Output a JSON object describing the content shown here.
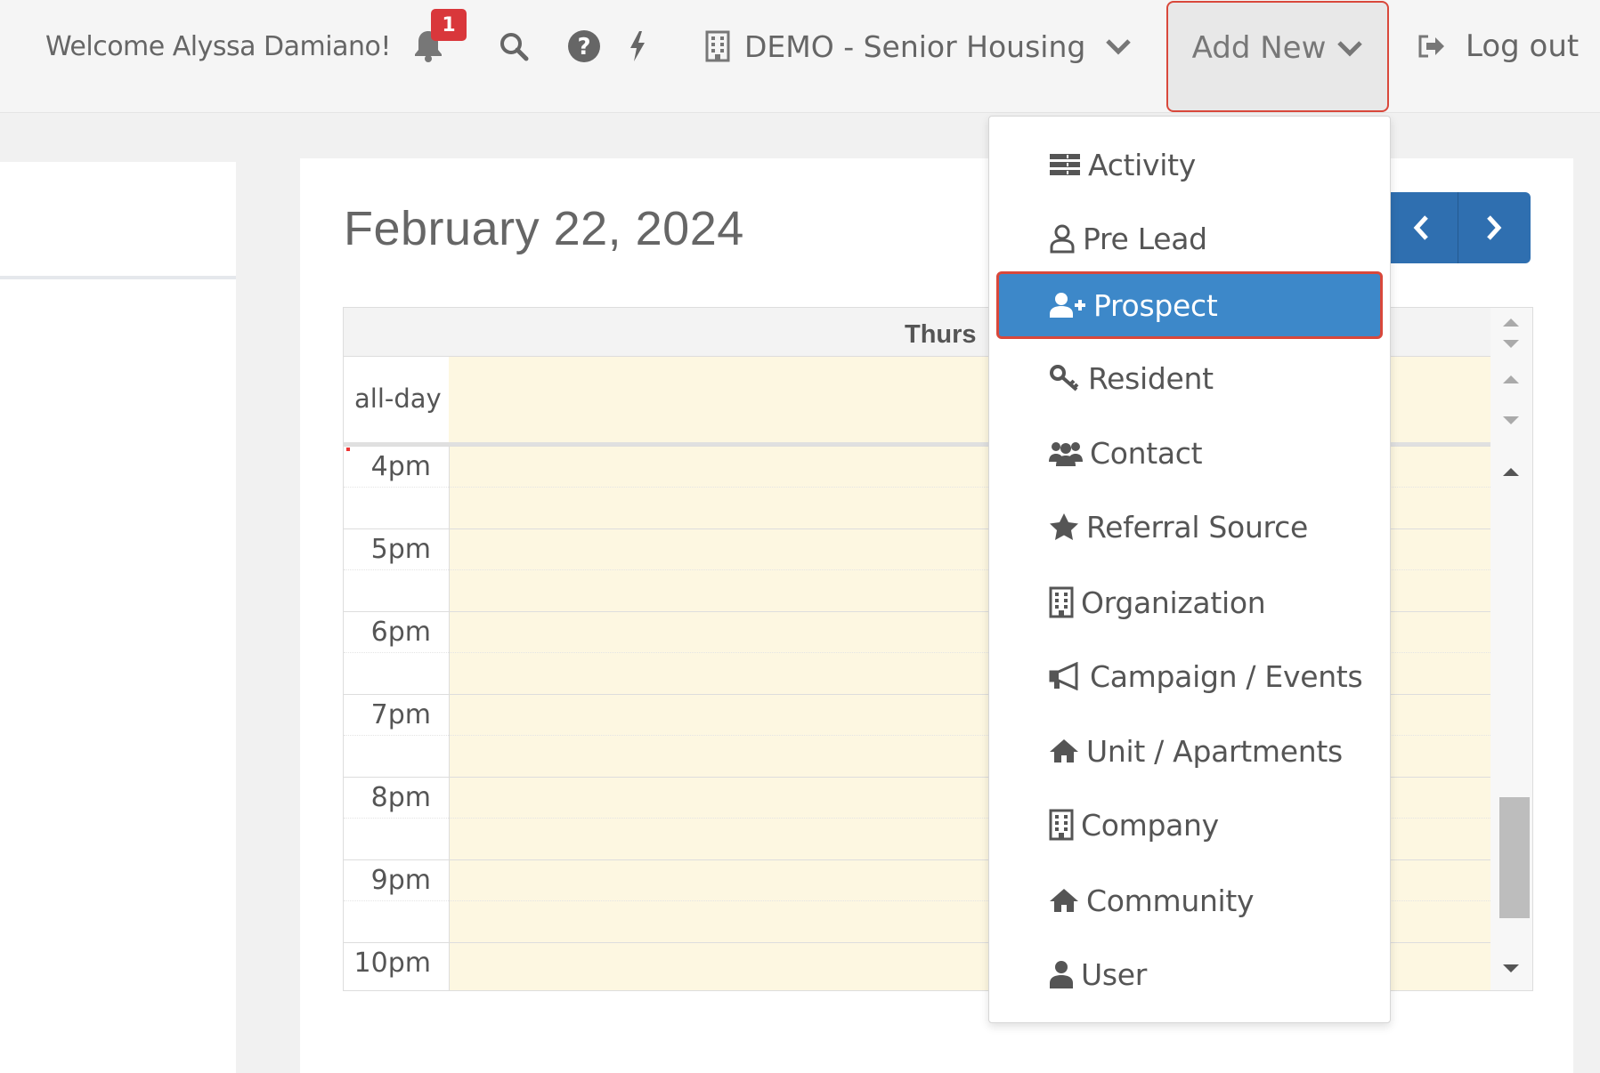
{
  "topbar": {
    "welcome": "Welcome Alyssa Damiano!",
    "notification_count": "1",
    "organization": "DEMO - Senior Housing",
    "add_new": "Add New",
    "logout": "Log out"
  },
  "calendar": {
    "date_title": "February 22, 2024",
    "day_header": "Thurs",
    "allday_label": "all-day",
    "hours": [
      "4pm",
      "5pm",
      "6pm",
      "7pm",
      "8pm",
      "9pm",
      "10pm"
    ]
  },
  "add_new_menu": {
    "items": [
      {
        "label": "Activity",
        "icon": "list-icon"
      },
      {
        "label": "Pre Lead",
        "icon": "user-outline-icon"
      },
      {
        "label": "Prospect",
        "icon": "user-plus-icon",
        "selected": true
      },
      {
        "label": "Resident",
        "icon": "key-icon"
      },
      {
        "label": "Contact",
        "icon": "users-icon"
      },
      {
        "label": "Referral Source",
        "icon": "star-icon"
      },
      {
        "label": "Organization",
        "icon": "building-icon"
      },
      {
        "label": "Campaign / Events",
        "icon": "bullhorn-icon"
      },
      {
        "label": "Unit / Apartments",
        "icon": "home-icon"
      },
      {
        "label": "Company",
        "icon": "building-icon"
      },
      {
        "label": "Community",
        "icon": "home-icon"
      },
      {
        "label": "User",
        "icon": "user-icon"
      }
    ]
  },
  "colors": {
    "highlight_border": "#d9483b",
    "selected_item": "#3d88c9",
    "nav_button": "#2f6fb0",
    "calendar_cell": "#fdf7e1"
  }
}
